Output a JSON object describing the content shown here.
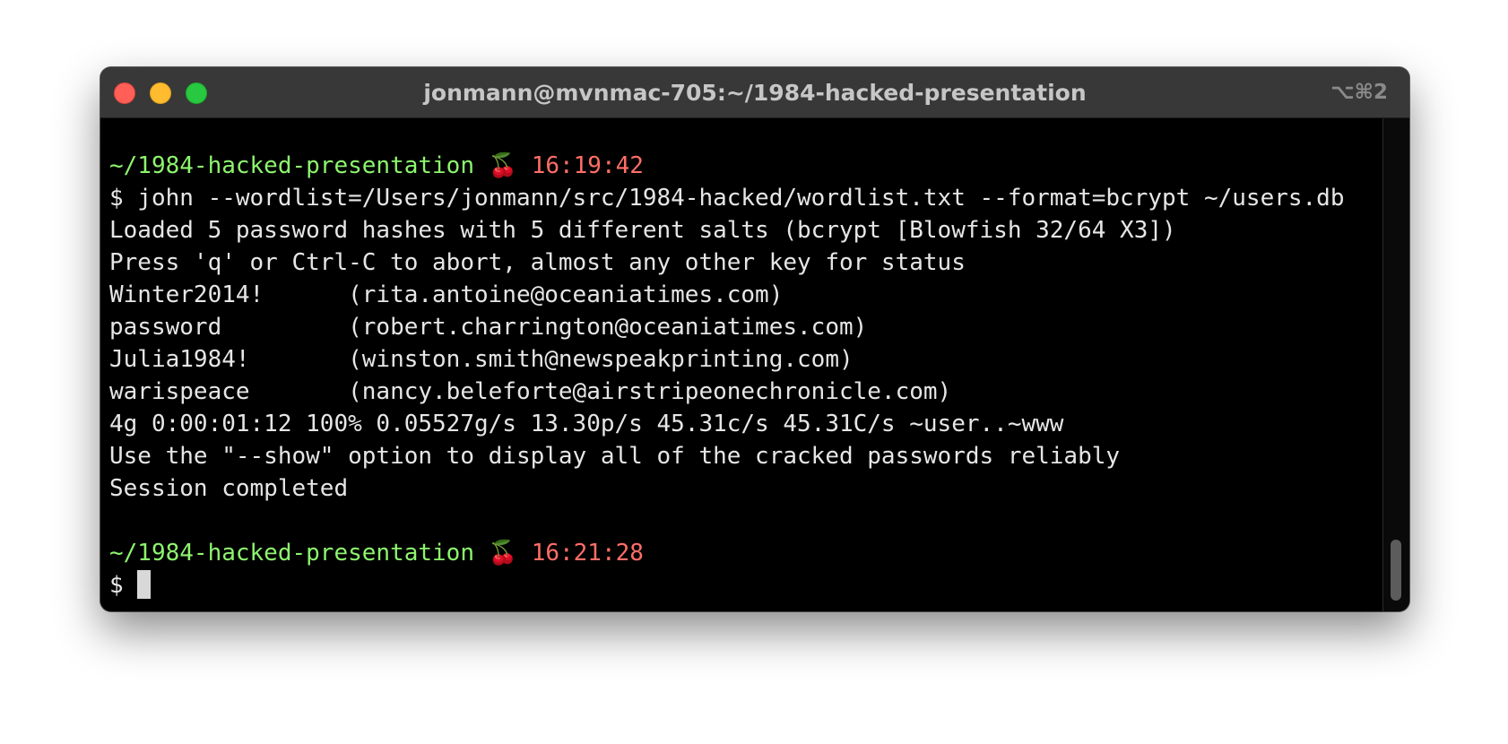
{
  "window": {
    "title": "jonmann@mvnmac-705:~/1984-hacked-presentation",
    "shortcut": "⌥⌘2"
  },
  "terminal": {
    "prompt1": {
      "path": "~/1984-hacked-presentation",
      "emoji": "🍒",
      "time": "16:19:42"
    },
    "command": "$ john --wordlist=/Users/jonmann/src/1984-hacked/wordlist.txt --format=bcrypt ~/users.db",
    "output": [
      "Loaded 5 password hashes with 5 different salts (bcrypt [Blowfish 32/64 X3])",
      "Press 'q' or Ctrl-C to abort, almost any other key for status",
      "Winter2014!      (rita.antoine@oceaniatimes.com)",
      "password         (robert.charrington@oceaniatimes.com)",
      "Julia1984!       (winston.smith@newspeakprinting.com)",
      "warispeace       (nancy.beleforte@airstripeonechronicle.com)",
      "4g 0:00:01:12 100% 0.05527g/s 13.30p/s 45.31c/s 45.31C/s ~user..~www",
      "Use the \"--show\" option to display all of the cracked passwords reliably",
      "Session completed"
    ],
    "prompt2": {
      "path": "~/1984-hacked-presentation",
      "emoji": "🍒",
      "time": "16:21:28"
    },
    "input_prompt": "$"
  },
  "colors": {
    "path": "#8df56e",
    "time": "#ff6e67",
    "text": "#e6e6e6",
    "background": "#000000",
    "titlebar": "#383838"
  }
}
